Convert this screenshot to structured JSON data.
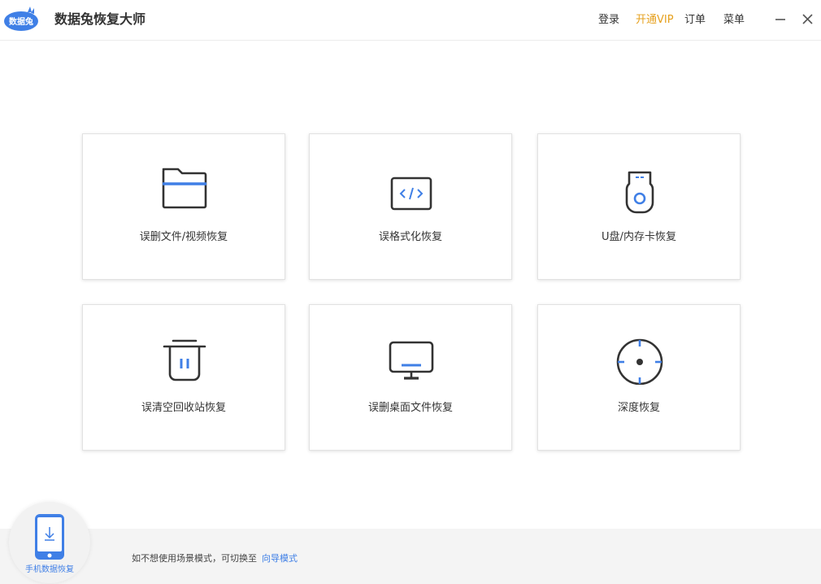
{
  "app": {
    "title": "数据兔恢复大师",
    "logo_text": "数据兔",
    "accent_color": "#3f7fe6",
    "vip_color": "#e6a01d"
  },
  "header": {
    "menu": {
      "login": "登录",
      "vip": "开通VIP",
      "orders": "订单",
      "menu": "菜单"
    },
    "window_controls": [
      "minimize-icon",
      "close-icon"
    ]
  },
  "cards": [
    {
      "label": "误删文件/视频恢复",
      "icon": "folder-icon"
    },
    {
      "label": "误格式化恢复",
      "icon": "code-window-icon"
    },
    {
      "label": "U盘/内存卡恢复",
      "icon": "usb-drive-icon"
    },
    {
      "label": "误清空回收站恢复",
      "icon": "trash-icon"
    },
    {
      "label": "误删桌面文件恢复",
      "icon": "monitor-icon"
    },
    {
      "label": "深度恢复",
      "icon": "crosshair-icon"
    }
  ],
  "footer": {
    "phone_recovery_label": "手机数据恢复",
    "hint_text": "如不想使用场景模式，可切换至",
    "hint_link": "向导模式"
  }
}
